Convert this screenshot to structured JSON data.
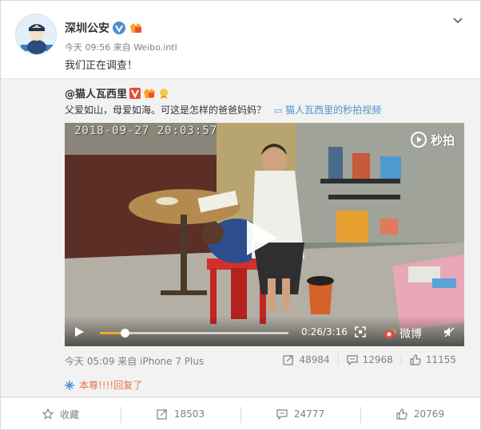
{
  "post": {
    "author": "深圳公安",
    "meta": "今天 09:56 来自 Weibo.intl",
    "text": "我们正在调查！"
  },
  "repost": {
    "author": "@猫人瓦西里",
    "text": "父爱如山，母爱如海。可这是怎样的爸爸妈妈？",
    "video_link": "猫人瓦西里的秒拍视频",
    "video": {
      "timestamp": "2018-09-27 20:03:57",
      "brand": "秒拍",
      "time": "0:26/3:16",
      "progress": 0.13,
      "weibo_label": "微博"
    },
    "footer": {
      "source": "今天 05:09 来自 iPhone 7 Plus",
      "reposts": "48984",
      "comments": "12968",
      "likes": "11155"
    }
  },
  "comment_line": "本尊!!!!回复了",
  "actions": {
    "favorite": "收藏",
    "repost": "18503",
    "comment": "24777",
    "like": "20769"
  },
  "colors": {
    "accent": "#eb7350",
    "link": "#4d8fcf",
    "progress": "#f7a51c"
  }
}
